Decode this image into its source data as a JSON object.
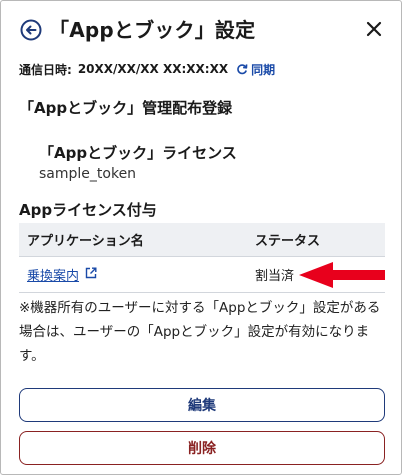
{
  "header": {
    "title": "「Appとブック」設定"
  },
  "sync": {
    "label": "通信日時:",
    "datetime": "20XX/XX/XX XX:XX:XX",
    "link_label": "同期"
  },
  "management": {
    "title": "「Appとブック」管理配布登録",
    "license_title": "「Appとブック」ライセンス",
    "license_token": "sample_token"
  },
  "assignment": {
    "title": "Appライセンス付与",
    "columns": [
      "アプリケーション名",
      "ステータス"
    ],
    "rows": [
      {
        "app_name": "乗換案内",
        "status": "割当済"
      }
    ]
  },
  "note": "※機器所有のユーザーに対する「Appとブック」設定がある場合は、ユーザーの「Appとブック」設定が有効になります。",
  "buttons": {
    "edit": "編集",
    "delete": "削除"
  },
  "colors": {
    "link": "#1a4aa8",
    "annotation_arrow": "#e8001c",
    "edit_border": "#1f3a7a",
    "delete_border": "#8a2222"
  }
}
